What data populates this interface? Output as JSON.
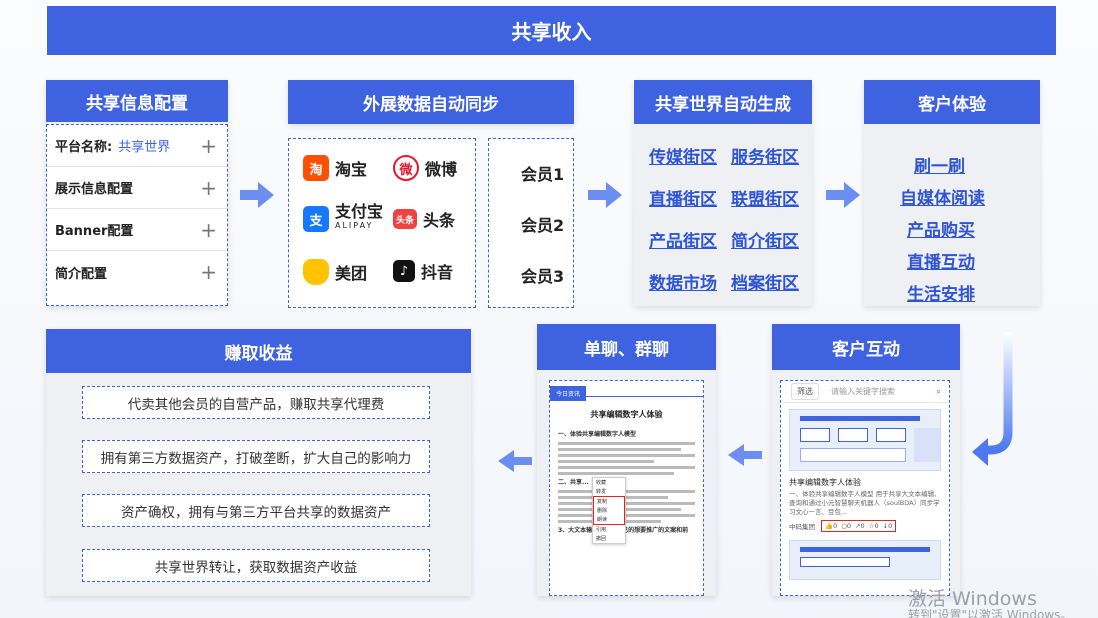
{
  "title": "共享收入",
  "config": {
    "header": "共享信息配置",
    "rows": [
      {
        "label": "平台名称:",
        "value": "共享世界"
      },
      {
        "label": "展示信息配置",
        "value": ""
      },
      {
        "label": "Banner配置",
        "value": ""
      },
      {
        "label": "简介配置",
        "value": ""
      }
    ]
  },
  "sync": {
    "header": "外展数据自动同步",
    "apps": [
      {
        "name": "淘宝",
        "icon": "taobao-icon",
        "glyph": "淘",
        "color": "#ff5000"
      },
      {
        "name": "微博",
        "icon": "weibo-icon",
        "glyph": "微",
        "color": "#e6162d"
      },
      {
        "name": "支付宝",
        "sub": "ALIPAY",
        "icon": "alipay-icon",
        "glyph": "支",
        "color": "#1677ff"
      },
      {
        "name": "头条",
        "icon": "toutiao-icon",
        "glyph": "头条",
        "color": "#f04142"
      },
      {
        "name": "美团",
        "icon": "meituan-icon",
        "glyph": "",
        "color": "#ffc300"
      },
      {
        "name": "抖音",
        "icon": "douyin-icon",
        "glyph": "♪",
        "color": "#111111"
      }
    ],
    "members": [
      "会员1",
      "会员2",
      "会员3"
    ]
  },
  "world": {
    "header": "共享世界自动生成",
    "links": [
      "传媒街区",
      "服务街区",
      "直播街区",
      "联盟街区",
      "产品街区",
      "简介街区",
      "数据市场",
      "档案街区"
    ]
  },
  "experience": {
    "header": "客户体验",
    "links": [
      "刷一刷",
      "自媒体阅读",
      "产品购买",
      "直播互动",
      "生活安排"
    ]
  },
  "earn": {
    "header": "赚取收益",
    "items": [
      "代卖其他会员的自营产品，赚取共享代理费",
      "拥有第三方数据资产，打破垄断，扩大自己的影响力",
      "资产确权，拥有与第三方平台共享的数据资产",
      "共享世界转让，获取数据资产收益"
    ]
  },
  "chat": {
    "header": "单聊、群聊",
    "tab": "今日资讯",
    "doc_title": "共享编辑数字人体验",
    "section1": "一、体验共享编辑数字人模型",
    "section2": "二、共享...",
    "section3": "3、大文本输入：录入自己的想要推广的文案和前",
    "menu": [
      "收藏",
      "转发",
      "复制",
      "删除",
      "朗读",
      "引用",
      "撤回"
    ]
  },
  "interact": {
    "header": "客户互动",
    "filter": "筛选",
    "search_placeholder": "请输入关键字搜索",
    "post_title": "共享编辑数字人体验",
    "post_text": "一、体验共享编辑数字人模型 用于共享大文本编辑、查询和通过小元智慧聊天机器人（soulBDA）同步学习文心一言、豆包...",
    "post_author": "中码集团",
    "stats": [
      "0",
      "0",
      "0",
      "0",
      "0"
    ]
  },
  "watermark": {
    "line1": "激活 Windows",
    "line2": "转到\"设置\"以激活 Windows。"
  }
}
